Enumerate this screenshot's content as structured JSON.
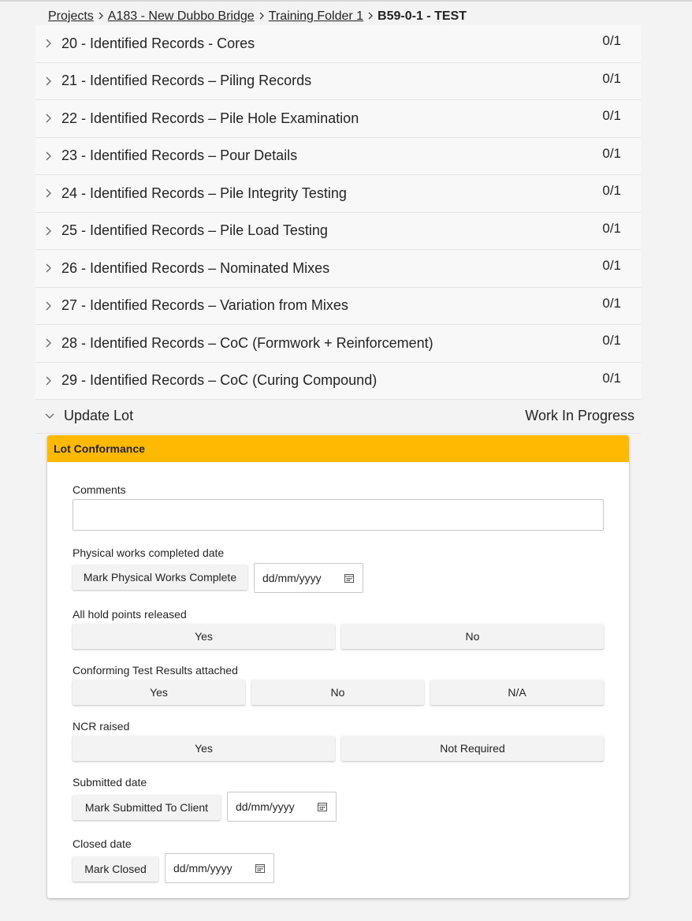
{
  "breadcrumb": {
    "items": [
      "Projects",
      "A183 - New Dubbo Bridge",
      "Training Folder 1"
    ],
    "current": "B59-0-1 - TEST"
  },
  "records": [
    {
      "label": "20 - Identified Records - Cores",
      "count": "0/1"
    },
    {
      "label": "21 - Identified Records – Piling Records",
      "count": "0/1"
    },
    {
      "label": "22 - Identified Records – Pile Hole Examination",
      "count": "0/1"
    },
    {
      "label": "23 - Identified Records – Pour Details",
      "count": "0/1"
    },
    {
      "label": "24 - Identified Records – Pile Integrity Testing",
      "count": "0/1"
    },
    {
      "label": "25 - Identified Records – Pile Load Testing",
      "count": "0/1"
    },
    {
      "label": "26 - Identified Records – Nominated Mixes",
      "count": "0/1"
    },
    {
      "label": "27 - Identified Records – Variation from Mixes",
      "count": "0/1"
    },
    {
      "label": "28 - Identified Records – CoC (Formwork + Reinforcement)",
      "count": "0/1"
    },
    {
      "label": "29 - Identified Records – CoC (Curing Compound)",
      "count": "0/1"
    }
  ],
  "update_lot": {
    "label": "Update Lot",
    "status": "Work In Progress"
  },
  "lot_conformance": {
    "title": "Lot Conformance",
    "header_color": "#ffb900",
    "comments_label": "Comments",
    "comments_value": "",
    "physical": {
      "label": "Physical works completed date",
      "button": "Mark Physical Works Complete",
      "date_placeholder": "dd/mm/yyyy"
    },
    "hold_points": {
      "label": "All hold points released",
      "yes": "Yes",
      "no": "No"
    },
    "test_results": {
      "label": "Conforming Test Results attached",
      "yes": "Yes",
      "no": "No",
      "na": "N/A"
    },
    "ncr": {
      "label": "NCR raised",
      "yes": "Yes",
      "not_required": "Not Required"
    },
    "submitted": {
      "label": "Submitted date",
      "button": "Mark Submitted To Client",
      "date_placeholder": "dd/mm/yyyy"
    },
    "closed": {
      "label": "Closed date",
      "button": "Mark Closed",
      "date_placeholder": "dd/mm/yyyy"
    }
  },
  "icons": {
    "row_chevron": "chevron-right-icon",
    "expanded_chevron": "chevron-down-icon",
    "date_picker": "calendar-icon"
  }
}
